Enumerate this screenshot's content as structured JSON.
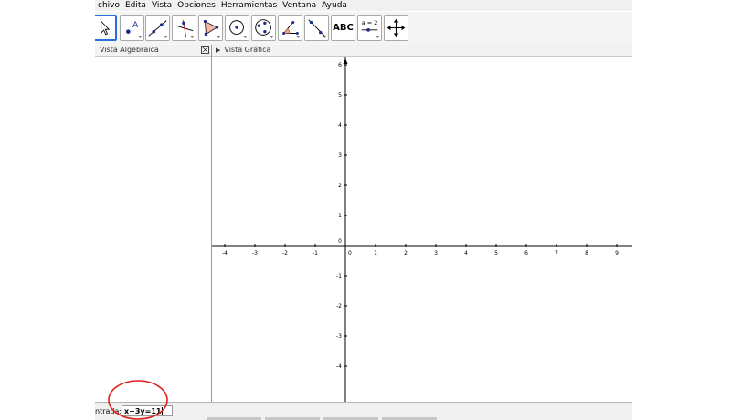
{
  "menubar": {
    "items": [
      "chivo",
      "Edita",
      "Vista",
      "Opciones",
      "Herramientas",
      "Ventana",
      "Ayuda"
    ]
  },
  "toolbar": {
    "tools": [
      {
        "icon": "move-arrow-icon",
        "active": true
      },
      {
        "icon": "new-point-icon",
        "label": "A"
      },
      {
        "icon": "line-through-points-icon"
      },
      {
        "icon": "perpendicular-line-icon"
      },
      {
        "icon": "polygon-icon"
      },
      {
        "icon": "circle-center-point-icon"
      },
      {
        "icon": "circle-three-points-icon"
      },
      {
        "icon": "angle-icon"
      },
      {
        "icon": "reflect-about-line-icon"
      },
      {
        "icon": "text-tool-icon",
        "label": "ABC"
      },
      {
        "icon": "slider-icon",
        "label": "a = 2"
      },
      {
        "icon": "move-graphics-view-icon"
      }
    ]
  },
  "algebra_view": {
    "title": "Vista Algebraica",
    "close_icon": "close-icon"
  },
  "graphics_view": {
    "title": "Vista Gráfica",
    "axes": {
      "x_ticks": [
        "-4",
        "-3",
        "-2",
        "-1",
        "0",
        "1",
        "2",
        "3",
        "4",
        "5",
        "6",
        "7",
        "8",
        "9"
      ],
      "y_ticks_positive": [
        "6",
        "5",
        "4",
        "3",
        "2",
        "1",
        "0"
      ],
      "y_ticks_negative": [
        "-1",
        "-2",
        "-3",
        "-4"
      ],
      "x_range": [
        -4,
        9
      ],
      "y_range": [
        -4,
        6
      ],
      "grid": false
    }
  },
  "input_bar": {
    "label": "ntrada:",
    "value": "x+3y=11"
  },
  "annotation": {
    "color": "#e0201c",
    "shape": "ellipse"
  }
}
